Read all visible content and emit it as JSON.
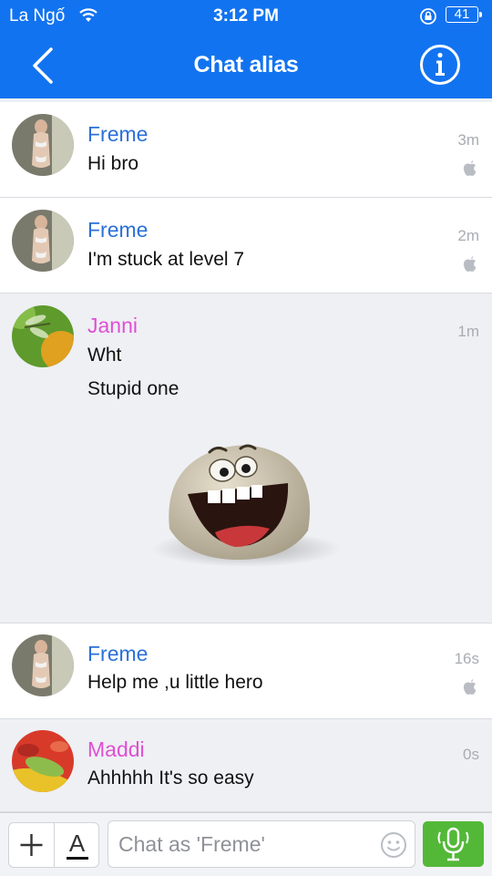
{
  "status_bar": {
    "carrier": "La Ngố",
    "time": "3:12 PM",
    "battery": "41"
  },
  "header": {
    "title": "Chat alias"
  },
  "messages": [
    {
      "name": "Freme",
      "lines": [
        "Hi bro"
      ],
      "time": "3m"
    },
    {
      "name": "Freme",
      "lines": [
        "I'm stuck at level 7"
      ],
      "time": "2m"
    },
    {
      "name": "Janni",
      "lines": [
        "Wht",
        "Stupid one"
      ],
      "time": "1m",
      "sticker": "laughing-blob-sticker"
    },
    {
      "name": "Freme",
      "lines": [
        "Help me ,u little hero"
      ],
      "time": "16s"
    },
    {
      "name": "Maddi",
      "lines": [
        "Ahhhhh It's so easy"
      ],
      "time": "0s"
    }
  ],
  "composer": {
    "placeholder": "Chat as 'Freme'",
    "font_label": "A"
  },
  "colors": {
    "header": "#1273f0",
    "sender_self": "#2a70d8",
    "sender_other": "#e04fd4",
    "mic": "#53b838"
  }
}
